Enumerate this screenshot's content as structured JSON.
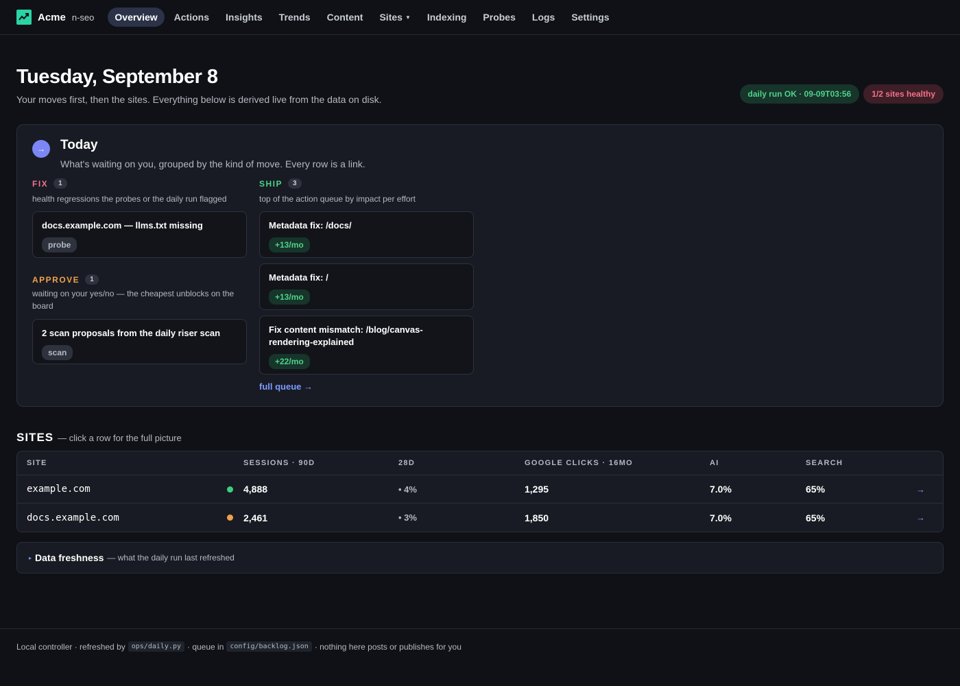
{
  "nav": {
    "brand": "Acme",
    "brand_sub": "n-seo",
    "items": [
      {
        "label": "Overview",
        "active": true
      },
      {
        "label": "Actions"
      },
      {
        "label": "Insights"
      },
      {
        "label": "Trends"
      },
      {
        "label": "Content"
      },
      {
        "label": "Sites",
        "dropdown": true
      },
      {
        "label": "Indexing"
      },
      {
        "label": "Probes"
      },
      {
        "label": "Logs"
      },
      {
        "label": "Settings"
      }
    ]
  },
  "header": {
    "title": "Tuesday, September 8",
    "subtitle": "Your moves first, then the sites. Everything below is derived live from the data on disk.",
    "badge_run": "daily run OK · 09-09T03:56",
    "badge_health": "1/2 sites healthy"
  },
  "today": {
    "title": "Today",
    "subtitle": "What's waiting on you, grouped by the kind of move. Every row is a link.",
    "fix": {
      "label": "FIX",
      "count": "1",
      "desc": "health regressions the probes or the daily run flagged",
      "items": [
        {
          "title": "docs.example.com — llms.txt missing",
          "tag": "probe"
        }
      ]
    },
    "approve": {
      "label": "APPROVE",
      "count": "1",
      "desc": "waiting on your yes/no — the cheapest unblocks on the board",
      "items": [
        {
          "title": "2 scan proposals from the daily riser scan",
          "tag": "scan"
        }
      ]
    },
    "ship": {
      "label": "SHIP",
      "count": "3",
      "desc": "top of the action queue by impact per effort",
      "items": [
        {
          "title": "Metadata fix: /docs/",
          "tag": "+13/mo"
        },
        {
          "title": "Metadata fix: /",
          "tag": "+13/mo"
        },
        {
          "title": "Fix content mismatch: /blog/canvas-rendering-explained",
          "tag": "+22/mo"
        }
      ],
      "link": "full queue →"
    }
  },
  "sites": {
    "title": "SITES",
    "subtitle": "— click a row for the full picture",
    "columns": [
      "SITE",
      "SESSIONS · 90D",
      "28D",
      "GOOGLE CLICKS · 16MO",
      "AI",
      "SEARCH"
    ],
    "rows": [
      {
        "site": "example.com",
        "status_color": "#3fcf7f",
        "sessions": "4,888",
        "d28": "• 4%",
        "clicks": "1,295",
        "ai": "7.0%",
        "search": "65%",
        "arrow": "→"
      },
      {
        "site": "docs.example.com",
        "status_color": "#f0a14a",
        "sessions": "2,461",
        "d28": "• 3%",
        "clicks": "1,850",
        "ai": "7.0%",
        "search": "65%",
        "arrow": "→"
      }
    ]
  },
  "freshness": {
    "caret": "▸",
    "title": "Data freshness",
    "subtitle": "— what the daily run last refreshed"
  },
  "footer": {
    "part1": "Local controller · refreshed by",
    "code1": "ops/daily.py",
    "part2": "· queue in",
    "code2": "config/backlog.json",
    "part3": "· nothing here posts or publishes for you"
  },
  "colors": {
    "accent": "#7b87f4",
    "brand": "#2bd4a4",
    "ok": "#4fd18b",
    "bad": "#f2708a",
    "warn": "#f0a14a"
  }
}
